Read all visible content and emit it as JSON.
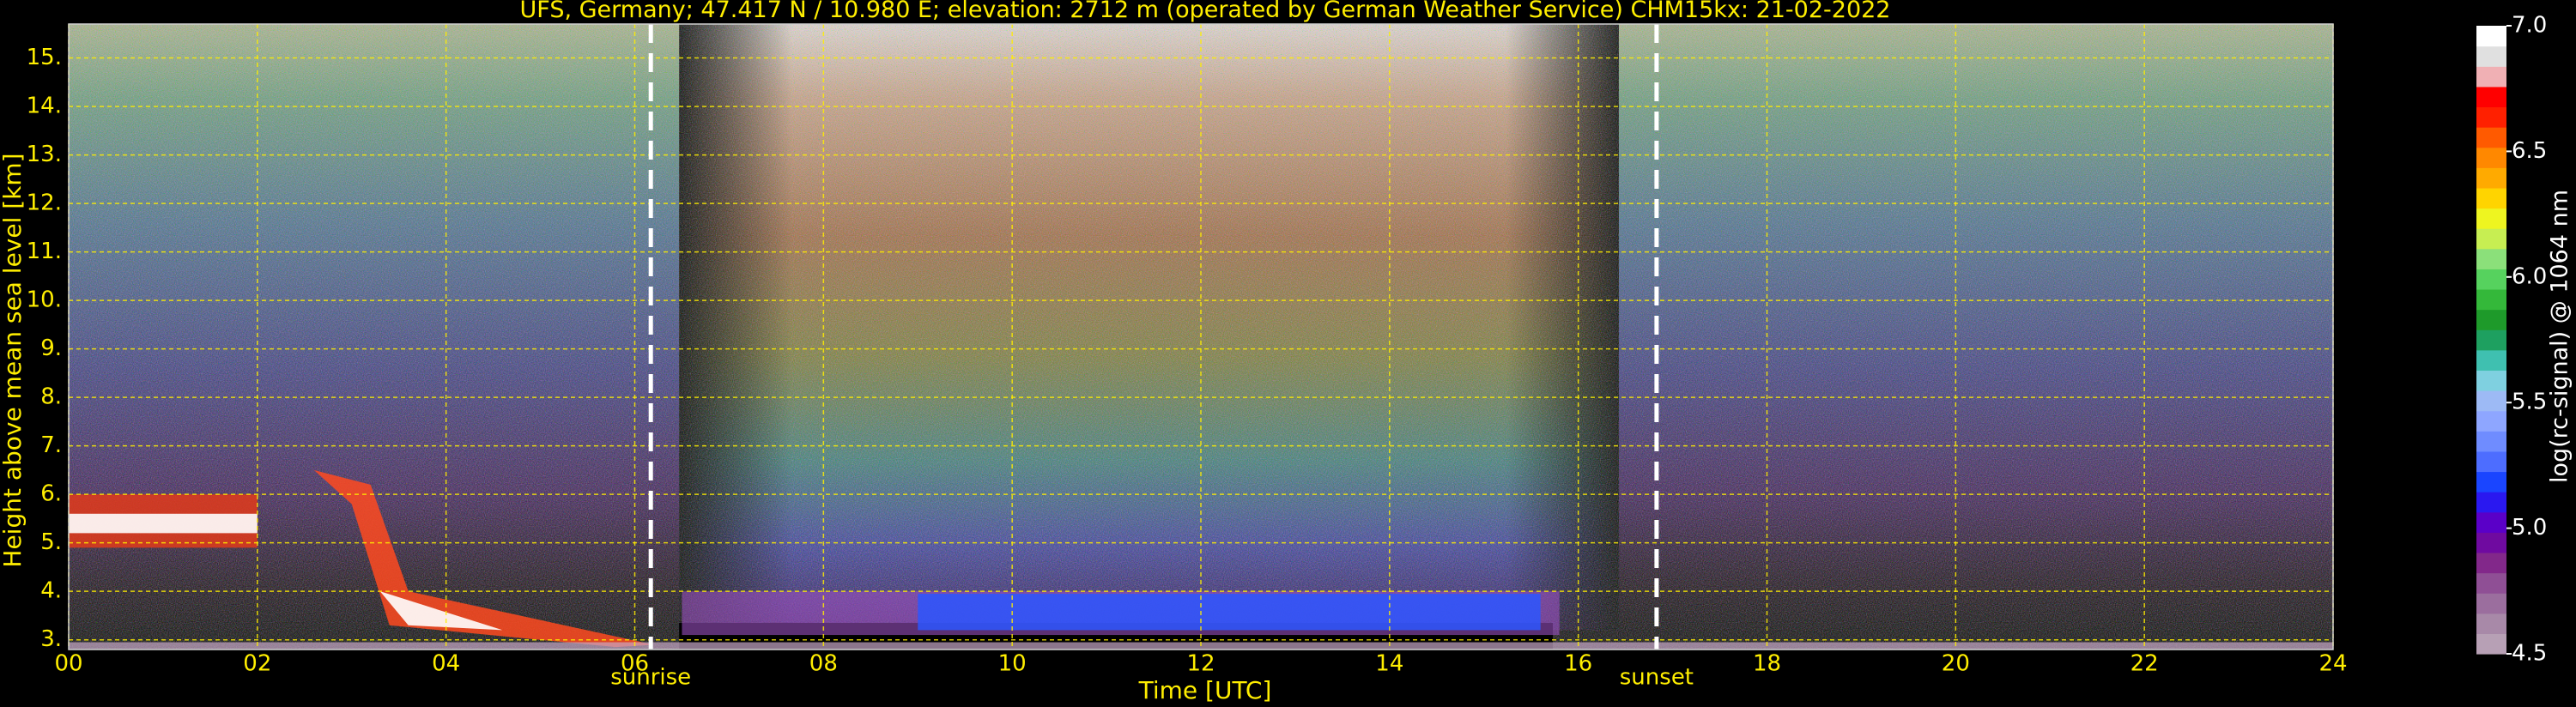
{
  "chart_data": {
    "type": "heatmap",
    "title": "UFS, Germany; 47.417 N / 10.980 E; elevation: 2712 m  (operated by German Weather Service)    CHM15kx: 21-02-2022",
    "xlabel": "Time [UTC]",
    "ylabel": "Height above mean sea level [km]",
    "xlim": [
      0,
      24
    ],
    "ylim": [
      2.8,
      15.7
    ],
    "x_ticks": [
      "00",
      "02",
      "04",
      "06",
      "08",
      "10",
      "12",
      "14",
      "16",
      "18",
      "20",
      "22",
      "24"
    ],
    "y_ticks": [
      "3.",
      "4.",
      "5.",
      "6.",
      "7.",
      "8.",
      "9.",
      "10.",
      "11.",
      "12.",
      "13.",
      "14.",
      "15."
    ],
    "grid": true,
    "events": [
      {
        "label": "sunrise",
        "x": 6.17
      },
      {
        "label": "sunset",
        "x": 16.83
      }
    ],
    "colorbar": {
      "label": "log(rc-signal) @ 1064 nm",
      "range": [
        4.5,
        7.0
      ],
      "ticks": [
        "4.5",
        "5.0",
        "5.5",
        "6.0",
        "6.5",
        "7.0"
      ],
      "colors": [
        "#b7a0b5",
        "#a889a8",
        "#9b6e9e",
        "#8f4f95",
        "#82288a",
        "#6f0aa0",
        "#5a00c8",
        "#2a18f0",
        "#1a45ff",
        "#4d6dff",
        "#6f8cff",
        "#8ea6ff",
        "#9dbaf5",
        "#7fd0e0",
        "#3fc0b0",
        "#1ea060",
        "#1e9a2a",
        "#34b83a",
        "#56d25e",
        "#8be07a",
        "#c7ee52",
        "#eef520",
        "#ffd400",
        "#ffaa00",
        "#ff8800",
        "#ff5a00",
        "#ff2000",
        "#ff0000",
        "#f0b0b4",
        "#e0e0e0",
        "#ffffff"
      ]
    },
    "features": [
      {
        "name": "low cloud layer",
        "x": [
          0,
          2.0
        ],
        "y": [
          4.9,
          6.0
        ]
      },
      {
        "name": "descending cloud",
        "x": [
          2.6,
          6.2
        ],
        "y": [
          2.9,
          6.5
        ]
      },
      {
        "name": "boundary layer",
        "x": [
          6.5,
          15.8
        ],
        "y": [
          3.1,
          4.0
        ]
      }
    ]
  }
}
